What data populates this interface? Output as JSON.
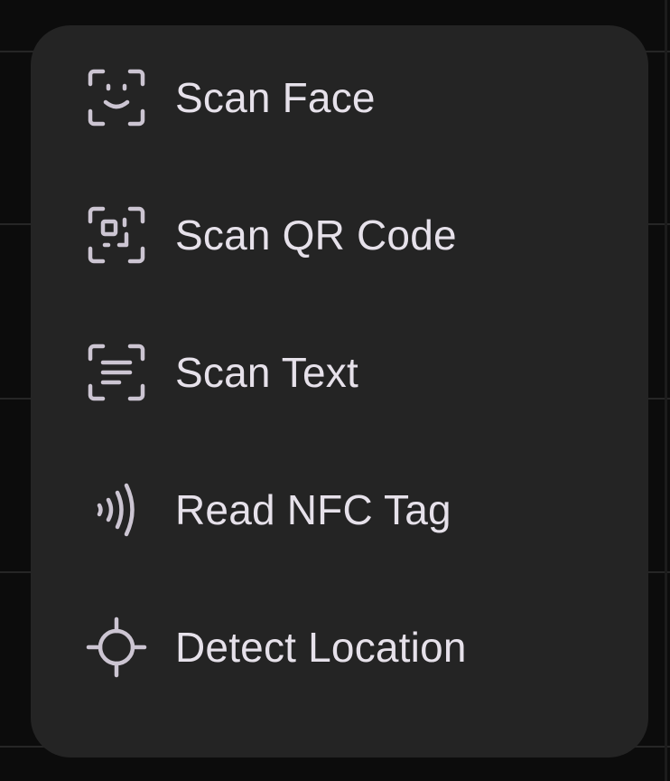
{
  "menu": {
    "items": [
      {
        "label": "Scan Face",
        "icon": "face-scan-icon"
      },
      {
        "label": "Scan QR Code",
        "icon": "qr-scan-icon"
      },
      {
        "label": "Scan Text",
        "icon": "text-scan-icon"
      },
      {
        "label": "Read NFC Tag",
        "icon": "nfc-icon"
      },
      {
        "label": "Detect Location",
        "icon": "location-crosshair-icon"
      }
    ]
  },
  "colors": {
    "menu_background": "#242424",
    "page_background": "#0c0c0c",
    "text": "#e6e1ea",
    "icon": "#ccc5d2"
  }
}
